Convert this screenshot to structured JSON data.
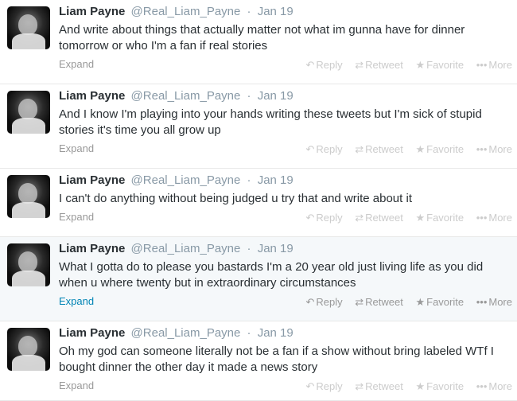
{
  "action_labels": {
    "reply": "Reply",
    "retweet": "Retweet",
    "favorite": "Favorite",
    "more": "More",
    "expand": "Expand"
  },
  "icons": {
    "reply": "reply-icon",
    "retweet": "retweet-icon",
    "favorite": "star-icon",
    "more": "more-dots-icon"
  },
  "colors": {
    "name": "#292f33",
    "meta": "#8899a6",
    "link": "#0084b4",
    "action_idle": "#cccccc",
    "action_hover": "#999999",
    "hover_bg": "#f5f8fa"
  },
  "tweets": [
    {
      "name": "Liam Payne",
      "handle": "@Real_Liam_Payne",
      "sep": "·",
      "date": "Jan 19",
      "text": "And write about things that actually matter not what im gunna have for dinner tomorrow or who I'm a fan if real stories"
    },
    {
      "name": "Liam Payne",
      "handle": "@Real_Liam_Payne",
      "sep": "·",
      "date": "Jan 19",
      "text": "And I know I'm playing into your hands writing these tweets but I'm sick of stupid stories it's time you all grow up"
    },
    {
      "name": "Liam Payne",
      "handle": "@Real_Liam_Payne",
      "sep": "·",
      "date": "Jan 19",
      "text": "I can't do anything without being judged u try that and write about it"
    },
    {
      "name": "Liam Payne",
      "handle": "@Real_Liam_Payne",
      "sep": "·",
      "date": "Jan 19",
      "text": "What I gotta do to please you bastards I'm a 20 year old just living life as you did when u where twenty but in extraordinary circumstances",
      "hovered": true
    },
    {
      "name": "Liam Payne",
      "handle": "@Real_Liam_Payne",
      "sep": "·",
      "date": "Jan 19",
      "text": "Oh my god can someone literally not be a fan if a show without bring labeled WTf I bought dinner the other day it made a news story"
    }
  ]
}
